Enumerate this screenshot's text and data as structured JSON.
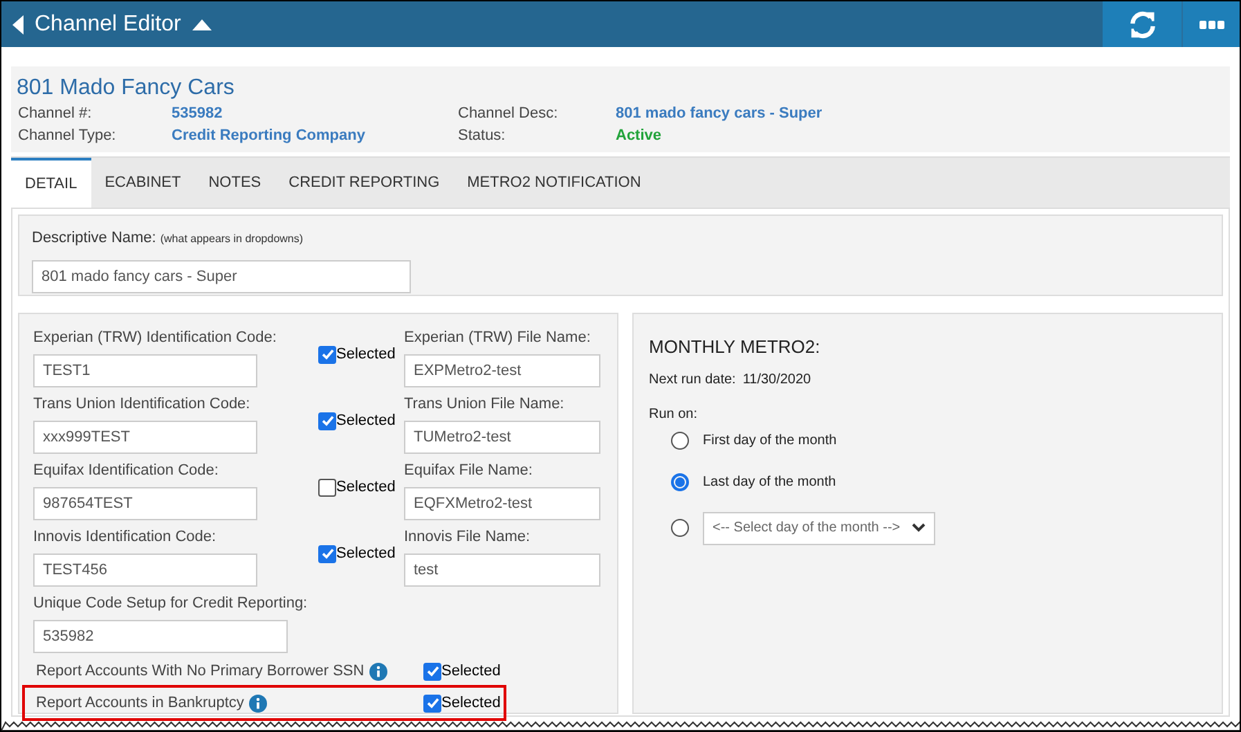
{
  "header": {
    "title": "Channel Editor"
  },
  "channel": {
    "name": "801 Mado Fancy Cars",
    "fields": [
      {
        "label": "Channel #:",
        "value": "535982",
        "kind": "link"
      },
      {
        "label": "Channel Desc:",
        "value": "801 mado fancy cars - Super",
        "kind": "link"
      },
      {
        "label": "Channel Type:",
        "value": "Credit Reporting Company",
        "kind": "link"
      },
      {
        "label": "Status:",
        "value": "Active",
        "kind": "status"
      }
    ]
  },
  "tabs": [
    {
      "label": "DETAIL",
      "selected": true
    },
    {
      "label": "ECABINET",
      "selected": false
    },
    {
      "label": "NOTES",
      "selected": false
    },
    {
      "label": "CREDIT REPORTING",
      "selected": false
    },
    {
      "label": "METRO2 NOTIFICATION",
      "selected": false
    }
  ],
  "descriptive_name": {
    "label": "Descriptive Name:",
    "hint": "(what appears in dropdowns)",
    "value": "801 mado fancy cars - Super"
  },
  "bureaus": [
    {
      "label": "Experian (TRW) Identification Code:",
      "value": "TEST1",
      "checkbox_label": "Selected",
      "checked": true,
      "file_label": "Experian (TRW) File Name:",
      "file_value": "EXPMetro2-test"
    },
    {
      "label": "Trans Union Identification Code:",
      "value": "xxx999TEST",
      "checkbox_label": "Selected",
      "checked": true,
      "file_label": "Trans Union File Name:",
      "file_value": "TUMetro2-test"
    },
    {
      "label": "Equifax Identification Code:",
      "value": "987654TEST",
      "checkbox_label": "Selected",
      "checked": false,
      "file_label": "Equifax File Name:",
      "file_value": "EQFXMetro2-test"
    },
    {
      "label": "Innovis Identification Code:",
      "value": "TEST456",
      "checkbox_label": "Selected",
      "checked": true,
      "file_label": "Innovis File Name:",
      "file_value": "test"
    }
  ],
  "unique_code": {
    "label": "Unique Code Setup for Credit Reporting:",
    "value": "535982"
  },
  "options": [
    {
      "label": "Report Accounts With No Primary Borrower SSN",
      "checkbox_label": "Selected",
      "checked": true,
      "highlighted": false
    },
    {
      "label": "Report Accounts in Bankruptcy",
      "checkbox_label": "Selected",
      "checked": true,
      "highlighted": true
    }
  ],
  "monthly": {
    "title": "MONTHLY METRO2:",
    "next_run_label": "Next run date:",
    "next_run_value": "11/30/2020",
    "run_on_label": "Run on:",
    "choices": [
      {
        "kind": "text",
        "label": "First day of the month",
        "selected": false
      },
      {
        "kind": "text",
        "label": "Last day of the month",
        "selected": true
      },
      {
        "kind": "select",
        "label": "<-- Select day of the month -->",
        "selected": false
      }
    ]
  }
}
